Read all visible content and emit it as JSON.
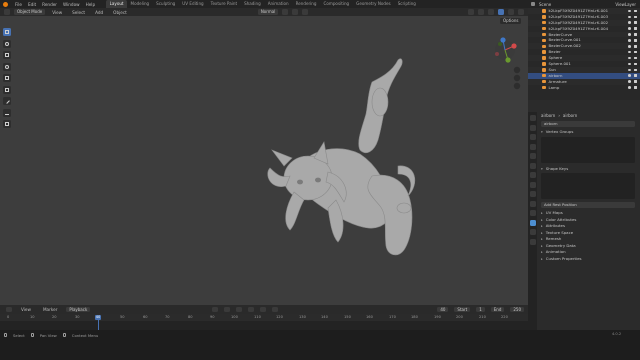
{
  "menubar": {
    "menus": [
      "File",
      "Edit",
      "Render",
      "Window",
      "Help"
    ],
    "workspaces": [
      "Layout",
      "Modeling",
      "Sculpting",
      "UV Editing",
      "Texture Paint",
      "Shading",
      "Animation",
      "Rendering",
      "Compositing",
      "Geometry Nodes",
      "Scripting"
    ],
    "active_workspace": "Layout"
  },
  "viewport_header": {
    "mode": "Object Mode",
    "menus": [
      "View",
      "Select",
      "Add",
      "Object"
    ],
    "orientation": "Normal",
    "options": "Options"
  },
  "timeline": {
    "menus": [
      "View",
      "Marker",
      "Playback"
    ],
    "current_frame": "40",
    "start_label": "Start",
    "start": "1",
    "end_label": "End",
    "end": "250",
    "ticks": [
      "0",
      "10",
      "20",
      "30",
      "40",
      "50",
      "60",
      "70",
      "80",
      "90",
      "100",
      "110",
      "120",
      "130",
      "140",
      "150",
      "160",
      "170",
      "180",
      "190",
      "200",
      "210",
      "220"
    ]
  },
  "right_top": {
    "scene": "Scene",
    "view_layer": "ViewLayer"
  },
  "outliner": {
    "rows": [
      {
        "name": "k2LkpF5X9Z0491Z7HnLrK.001"
      },
      {
        "name": "k2LkpF5X9Z0491Z7HnLrK.003"
      },
      {
        "name": "k2LkpF5X9Z0491Z7HnLrK.002"
      },
      {
        "name": "k2LkpF5X9Z0491Z7HnLrK.004"
      },
      {
        "name": "BezierCurve"
      },
      {
        "name": "BezierCurve.001"
      },
      {
        "name": "BezierCurve.002"
      },
      {
        "name": "Bezier"
      },
      {
        "name": "Sphere"
      },
      {
        "name": "Sphere.001"
      },
      {
        "name": "Sun"
      },
      {
        "name": "airborn",
        "selected": true
      },
      {
        "name": "Armature"
      },
      {
        "name": "Lamp"
      }
    ]
  },
  "properties": {
    "breadcrumb": [
      "airborn",
      "airborn"
    ],
    "mesh_name": "airborn",
    "panels": {
      "vertex_groups": "Vertex Groups",
      "shape_keys": "Shape Keys",
      "add_rest_position": "Add Rest Position",
      "closed": [
        "UV Maps",
        "Color Attributes",
        "Attributes",
        "Texture Space",
        "Remesh",
        "Geometry Data",
        "Animation",
        "Custom Properties"
      ]
    }
  },
  "statusbar": {
    "items": [
      "Select",
      "Pan View",
      "Context Menu"
    ],
    "version": "4.0.2"
  }
}
